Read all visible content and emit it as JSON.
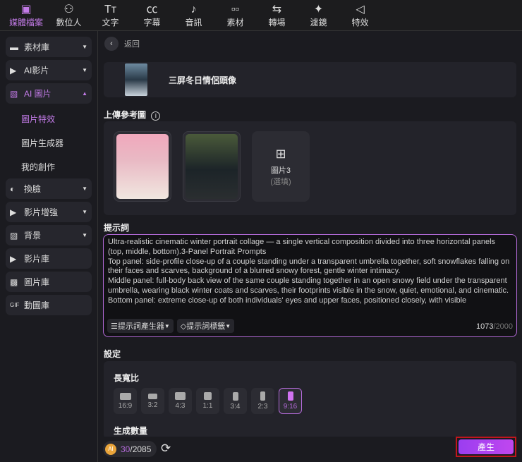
{
  "topbar": [
    {
      "label": "媒體檔案",
      "icon": "media-icon",
      "active": true
    },
    {
      "label": "數位人",
      "icon": "avatar-icon"
    },
    {
      "label": "文字",
      "icon": "text-icon"
    },
    {
      "label": "字幕",
      "icon": "subtitle-icon"
    },
    {
      "label": "音訊",
      "icon": "music-icon"
    },
    {
      "label": "素材",
      "icon": "elements-icon"
    },
    {
      "label": "轉場",
      "icon": "transition-icon"
    },
    {
      "label": "濾鏡",
      "icon": "filter-icon"
    },
    {
      "label": "特效",
      "icon": "effects-icon"
    }
  ],
  "sidebar": {
    "items": [
      {
        "label": "素材庫"
      },
      {
        "label": "AI影片"
      },
      {
        "label": "AI 圖片"
      },
      {
        "label": "換臉"
      },
      {
        "label": "影片增強"
      },
      {
        "label": "背景"
      },
      {
        "label": "影片庫"
      },
      {
        "label": "圖片庫"
      },
      {
        "label": "動圖庫"
      }
    ],
    "sub": [
      "圖片特效",
      "圖片生成器",
      "我的創作"
    ]
  },
  "main": {
    "back": "返回",
    "template": "三屏冬日情侶頭像",
    "upload_label": "上傳參考圖",
    "image3": "圖片3",
    "image3_opt": "(選填)",
    "prompt_label": "提示詞",
    "prompt": "Ultra-realistic cinematic winter portrait collage — a single vertical composition divided into three horizontal panels (top, middle, bottom).3-Panel Portrait Prompts\nTop panel: side-profile close-up of a couple standing under a transparent umbrella together, soft snowflakes falling on their faces and scarves, background of a blurred snowy forest, gentle winter intimacy.\nMiddle panel: full-body back view of the same couple standing together in an open snowy field under the transparent umbrella, wearing black winter coats and scarves, their footprints visible in the snow, quiet, emotional, and cinematic.\nBottom panel: extreme close-up of both individuals' eyes and upper faces, positioned closely, with visible",
    "prompt_gen": "提示詞產生器",
    "prompt_tags": "提示詞標籤",
    "count": "1073",
    "max": "/2000",
    "settings": "設定",
    "aspect_label": "長寬比",
    "ratios": [
      "16:9",
      "3:2",
      "4:3",
      "1:1",
      "3:4",
      "2:3",
      "9:16"
    ],
    "selected_ratio": "9:16",
    "quantity_label": "生成數量",
    "credits_used": "30",
    "credits_total": "/2085",
    "coin": "AI",
    "generate": "產生"
  }
}
